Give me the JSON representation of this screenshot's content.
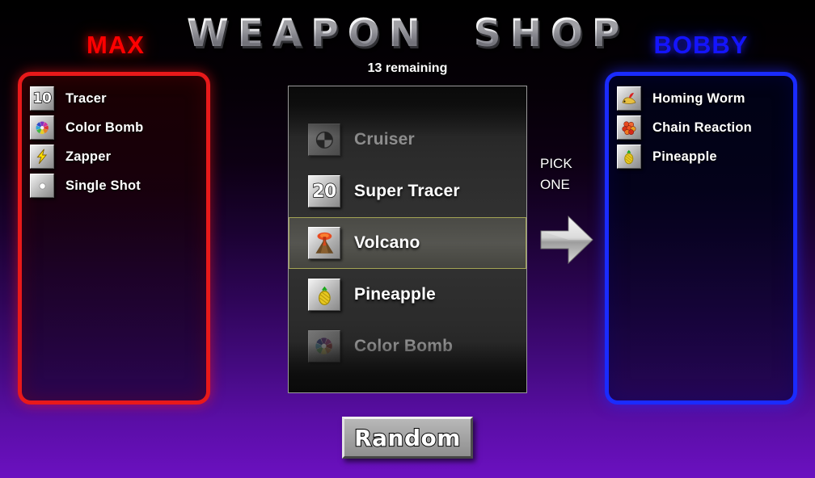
{
  "header": {
    "title": "WEAPON  SHOP",
    "remaining": "13 remaining"
  },
  "players": {
    "left": {
      "name": "MAX",
      "color": "#ff0000",
      "items": [
        {
          "label": "Tracer",
          "icon": "number-10-icon",
          "badge": "10"
        },
        {
          "label": "Color Bomb",
          "icon": "color-wheel-icon",
          "badge": ""
        },
        {
          "label": "Zapper",
          "icon": "lightning-bolt-icon",
          "badge": ""
        },
        {
          "label": "Single Shot",
          "icon": "single-dot-icon",
          "badge": ""
        }
      ]
    },
    "right": {
      "name": "BOBBY",
      "color": "#0000ff",
      "items": [
        {
          "label": "Homing Worm",
          "icon": "homing-worm-icon",
          "badge": ""
        },
        {
          "label": "Chain Reaction",
          "icon": "chain-reaction-icon",
          "badge": ""
        },
        {
          "label": "Pineapple",
          "icon": "pineapple-icon",
          "badge": ""
        }
      ]
    }
  },
  "shop": {
    "selected_index": 2,
    "rows": [
      {
        "label": "",
        "icon": "blank-icon",
        "badge": "",
        "state": "faded"
      },
      {
        "label": "Cruiser",
        "icon": "cruiser-ball-icon",
        "badge": "",
        "state": "dim"
      },
      {
        "label": "Super Tracer",
        "icon": "number-20-icon",
        "badge": "20",
        "state": "normal"
      },
      {
        "label": "Volcano",
        "icon": "volcano-icon",
        "badge": "",
        "state": "selected"
      },
      {
        "label": "Pineapple",
        "icon": "pineapple-icon",
        "badge": "",
        "state": "normal"
      },
      {
        "label": "Color Bomb",
        "icon": "color-wheel-icon",
        "badge": "",
        "state": "dim"
      },
      {
        "label": "",
        "icon": "blank-icon",
        "badge": "",
        "state": "faded"
      }
    ]
  },
  "pick": {
    "line1": "PICK",
    "line2": "ONE",
    "arrow": "arrow-right-icon"
  },
  "actions": {
    "random_label": "Random"
  },
  "theme": {
    "selection_border": "#a4a455",
    "max_border": "#e8191a",
    "bobby_border": "#1a2bff"
  }
}
